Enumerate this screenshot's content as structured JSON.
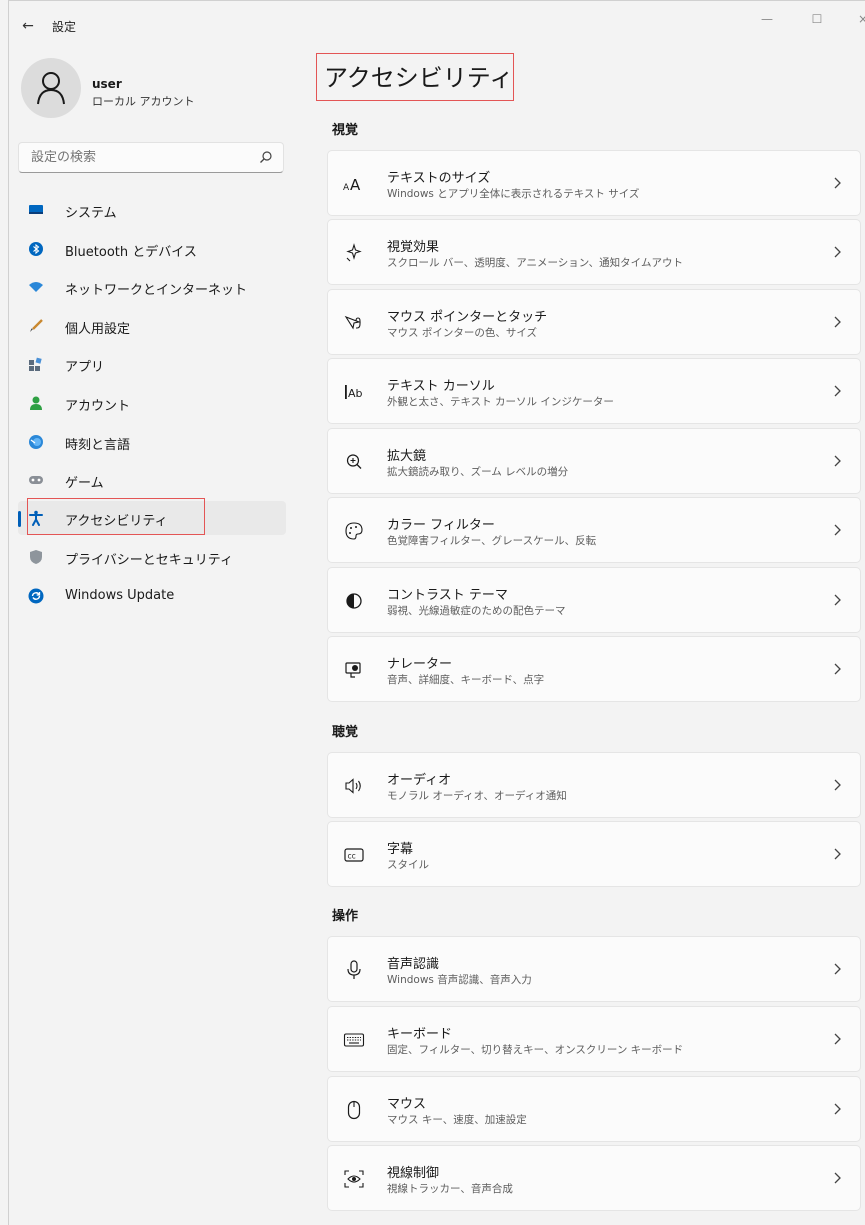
{
  "window": {
    "back_glyph": "←",
    "title": "設定",
    "minimize_glyph": "—",
    "maximize_glyph": "☐",
    "close_glyph": "×"
  },
  "user": {
    "name": "user",
    "account_type": "ローカル アカウント"
  },
  "search": {
    "placeholder": "設定の検索"
  },
  "sidebar": {
    "items": [
      {
        "label": "システム",
        "icon": "system-icon",
        "active": false
      },
      {
        "label": "Bluetooth とデバイス",
        "icon": "bluetooth-icon",
        "active": false
      },
      {
        "label": "ネットワークとインターネット",
        "icon": "network-icon",
        "active": false
      },
      {
        "label": "個人用設定",
        "icon": "personalization-icon",
        "active": false
      },
      {
        "label": "アプリ",
        "icon": "apps-icon",
        "active": false
      },
      {
        "label": "アカウント",
        "icon": "accounts-icon",
        "active": false
      },
      {
        "label": "時刻と言語",
        "icon": "time-language-icon",
        "active": false
      },
      {
        "label": "ゲーム",
        "icon": "gaming-icon",
        "active": false
      },
      {
        "label": "アクセシビリティ",
        "icon": "accessibility-icon",
        "active": true
      },
      {
        "label": "プライバシーとセキュリティ",
        "icon": "privacy-icon",
        "active": false
      },
      {
        "label": "Windows Update",
        "icon": "windows-update-icon",
        "active": false
      }
    ]
  },
  "main": {
    "title": "アクセシビリティ",
    "sections": [
      {
        "heading": "視覚",
        "items": [
          {
            "title": "テキストのサイズ",
            "subtitle": "Windows とアプリ全体に表示されるテキスト サイズ",
            "icon": "text-size-icon"
          },
          {
            "title": "視覚効果",
            "subtitle": "スクロール バー、透明度、アニメーション、通知タイムアウト",
            "icon": "visual-effects-icon"
          },
          {
            "title": "マウス ポインターとタッチ",
            "subtitle": "マウス ポインターの色、サイズ",
            "icon": "mouse-pointer-icon"
          },
          {
            "title": "テキスト カーソル",
            "subtitle": "外観と太さ、テキスト カーソル インジケーター",
            "icon": "text-cursor-icon"
          },
          {
            "title": "拡大鏡",
            "subtitle": "拡大鏡読み取り、ズーム レベルの増分",
            "icon": "magnifier-icon"
          },
          {
            "title": "カラー フィルター",
            "subtitle": "色覚障害フィルター、グレースケール、反転",
            "icon": "color-filter-icon"
          },
          {
            "title": "コントラスト テーマ",
            "subtitle": "弱視、光線過敏症のための配色テーマ",
            "icon": "contrast-icon"
          },
          {
            "title": "ナレーター",
            "subtitle": "音声、詳細度、キーボード、点字",
            "icon": "narrator-icon"
          }
        ]
      },
      {
        "heading": "聴覚",
        "items": [
          {
            "title": "オーディオ",
            "subtitle": "モノラル オーディオ、オーディオ通知",
            "icon": "audio-icon"
          },
          {
            "title": "字幕",
            "subtitle": "スタイル",
            "icon": "captions-icon"
          }
        ]
      },
      {
        "heading": "操作",
        "items": [
          {
            "title": "音声認識",
            "subtitle": "Windows 音声認識、音声入力",
            "icon": "microphone-icon"
          },
          {
            "title": "キーボード",
            "subtitle": "固定、フィルター、切り替えキー、オンスクリーン キーボード",
            "icon": "keyboard-icon"
          },
          {
            "title": "マウス",
            "subtitle": "マウス キー、速度、加速設定",
            "icon": "mouse-icon"
          },
          {
            "title": "視線制御",
            "subtitle": "視線トラッカー、音声合成",
            "icon": "eye-control-icon"
          }
        ]
      }
    ]
  },
  "colors": {
    "accent": "#005fb8",
    "highlight": "#e35555",
    "background": "#f3f3f3",
    "card": "#fbfbfb"
  }
}
